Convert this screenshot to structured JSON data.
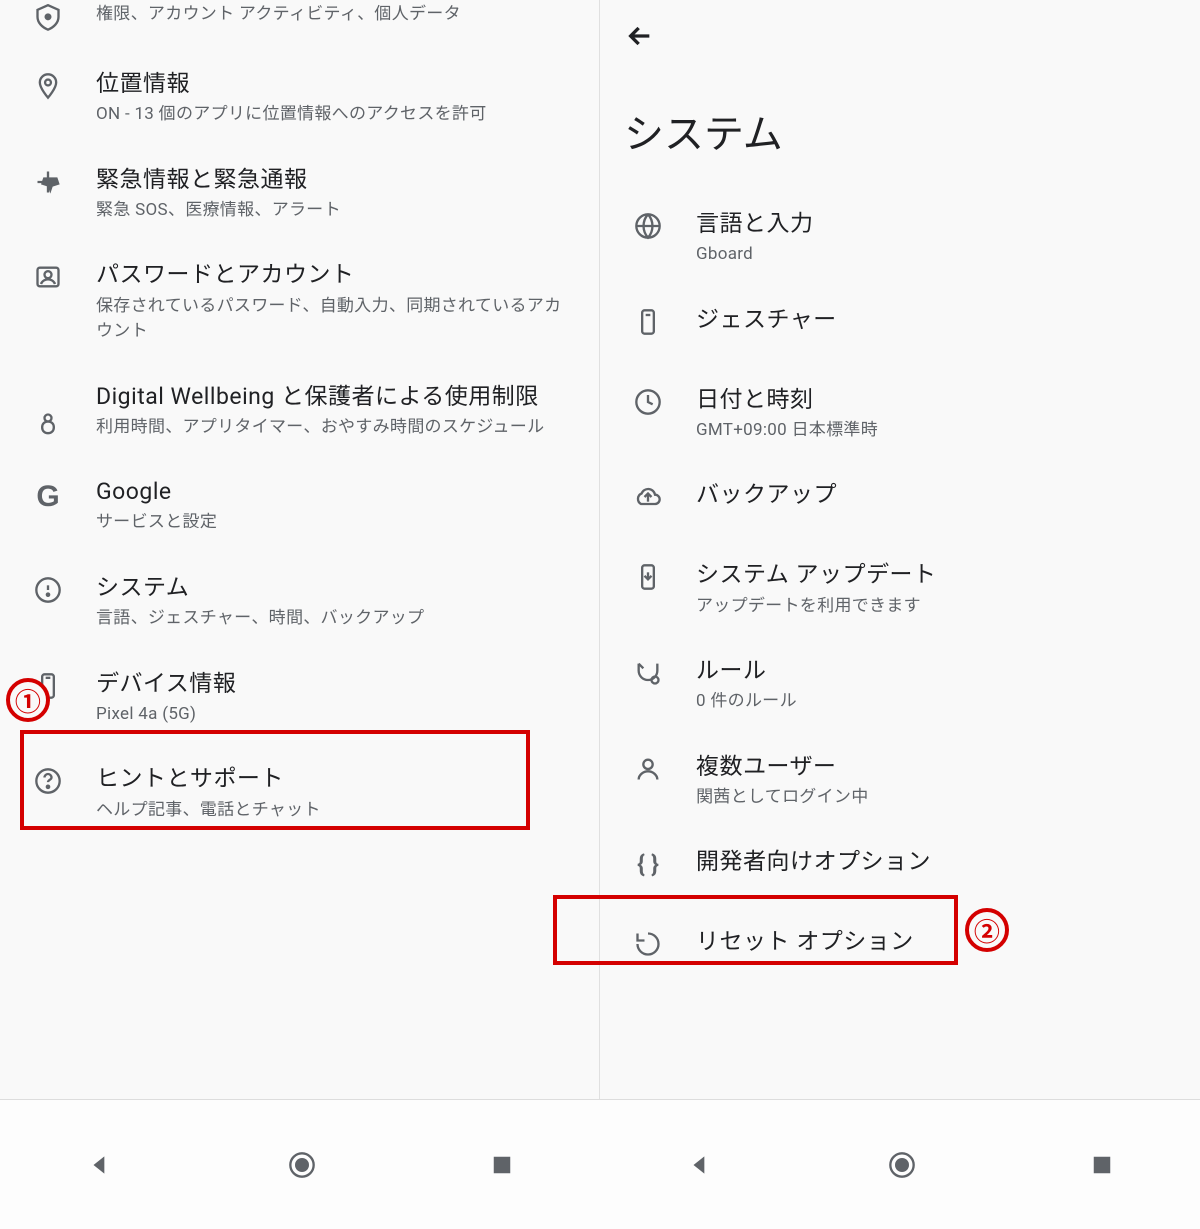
{
  "left": {
    "items": [
      {
        "title": "",
        "sub": "権限、アカウント アクティビティ、個人データ"
      },
      {
        "title": "位置情報",
        "sub": "ON - 13 個のアプリに位置情報へのアクセスを許可"
      },
      {
        "title": "緊急情報と緊急通報",
        "sub": "緊急 SOS、医療情報、アラート"
      },
      {
        "title": "パスワードとアカウント",
        "sub": "保存されているパスワード、自動入力、同期されているアカウント"
      },
      {
        "title": "Digital Wellbeing と保護者による使用制限",
        "sub": "利用時間、アプリタイマー、おやすみ時間のスケジュール"
      },
      {
        "title": "Google",
        "sub": "サービスと設定"
      },
      {
        "title": "システム",
        "sub": "言語、ジェスチャー、時間、バックアップ"
      },
      {
        "title": "デバイス情報",
        "sub": "Pixel 4a (5G)"
      },
      {
        "title": "ヒントとサポート",
        "sub": "ヘルプ記事、電話とチャット"
      }
    ]
  },
  "right": {
    "page_title": "システム",
    "items": [
      {
        "title": "言語と入力",
        "sub": "Gboard"
      },
      {
        "title": "ジェスチャー",
        "sub": ""
      },
      {
        "title": "日付と時刻",
        "sub": "GMT+09:00 日本標準時"
      },
      {
        "title": "バックアップ",
        "sub": ""
      },
      {
        "title": "システム アップデート",
        "sub": "アップデートを利用できます"
      },
      {
        "title": "ルール",
        "sub": "0 件のルール"
      },
      {
        "title": "複数ユーザー",
        "sub": "関茜としてログイン中"
      },
      {
        "title": "開発者向けオプション",
        "sub": ""
      },
      {
        "title": "リセット オプション",
        "sub": ""
      }
    ]
  },
  "annotations": {
    "badge1": "①",
    "badge2": "②"
  }
}
